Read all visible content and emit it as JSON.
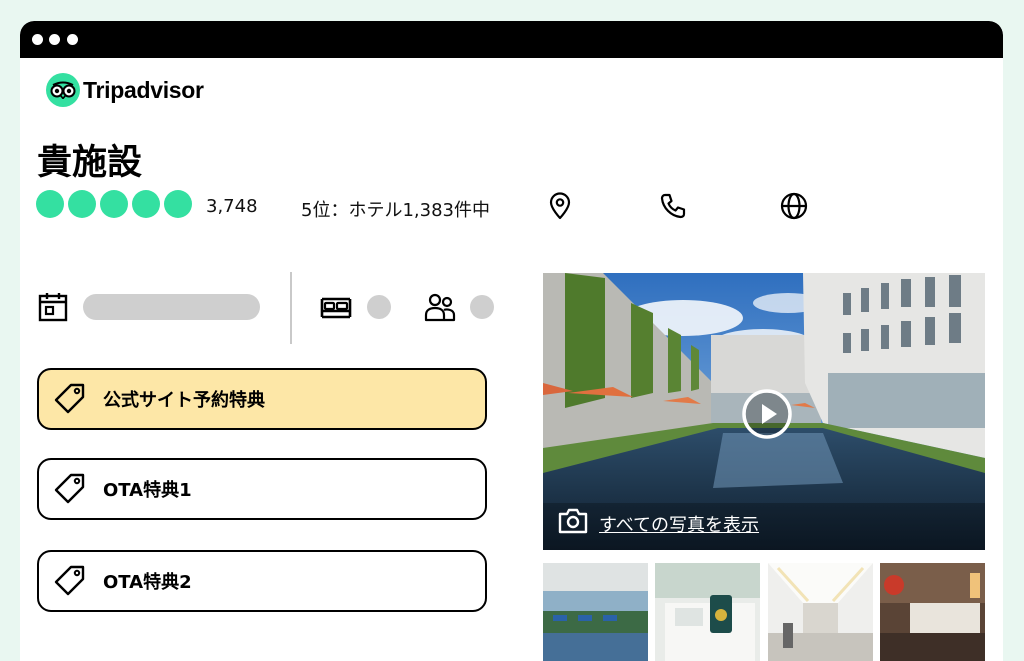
{
  "brand": {
    "name": "Tripadvisor",
    "color": "#34e0a1"
  },
  "hotel": {
    "name": "貴施設"
  },
  "rating": {
    "bubbles": 5,
    "filled": 5,
    "review_count": "3,748",
    "ranking": "5位：ホテル1,383件中"
  },
  "header_icons": [
    "map-pin-icon",
    "phone-icon",
    "globe-icon"
  ],
  "search": {
    "date_icon": "calendar-icon",
    "rooms_icon": "bed-icon",
    "guests_icon": "guests-icon"
  },
  "offers": [
    {
      "label": "公式サイト予約特典",
      "highlight_color": "#fde7a7"
    },
    {
      "label": "OTA特典1"
    },
    {
      "label": "OTA特典2"
    }
  ],
  "gallery": {
    "view_all_label": "すべての写真を表示",
    "play_icon": "play-icon",
    "camera_icon": "camera-icon"
  }
}
